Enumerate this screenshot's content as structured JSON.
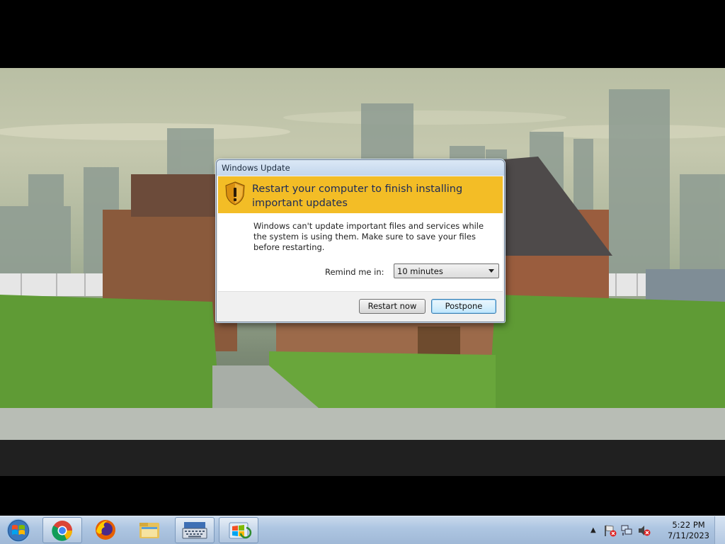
{
  "dialog": {
    "title": "Windows Update",
    "heading": "Restart your computer to finish installing important updates",
    "message": "Windows can't update important files and services while the system is using them. Make sure to save your files before restarting.",
    "remind_label": "Remind me in:",
    "remind_value": "10 minutes",
    "restart_label": "Restart now",
    "postpone_label": "Postpone"
  },
  "taskbar": {
    "pinned": [
      "start-orb-icon",
      "chrome-icon",
      "firefox-icon",
      "file-explorer-icon",
      "on-screen-keyboard-icon",
      "windows-update-icon"
    ],
    "tray_icons": [
      "show-hidden-icons-arrow",
      "action-center-flag-icon",
      "network-icon",
      "volume-muted-icon"
    ],
    "time": "5:22 PM",
    "date": "7/11/2023"
  },
  "colors": {
    "header_yellow": "#f3bd26",
    "taskbar_blue": "#aec6e2"
  }
}
